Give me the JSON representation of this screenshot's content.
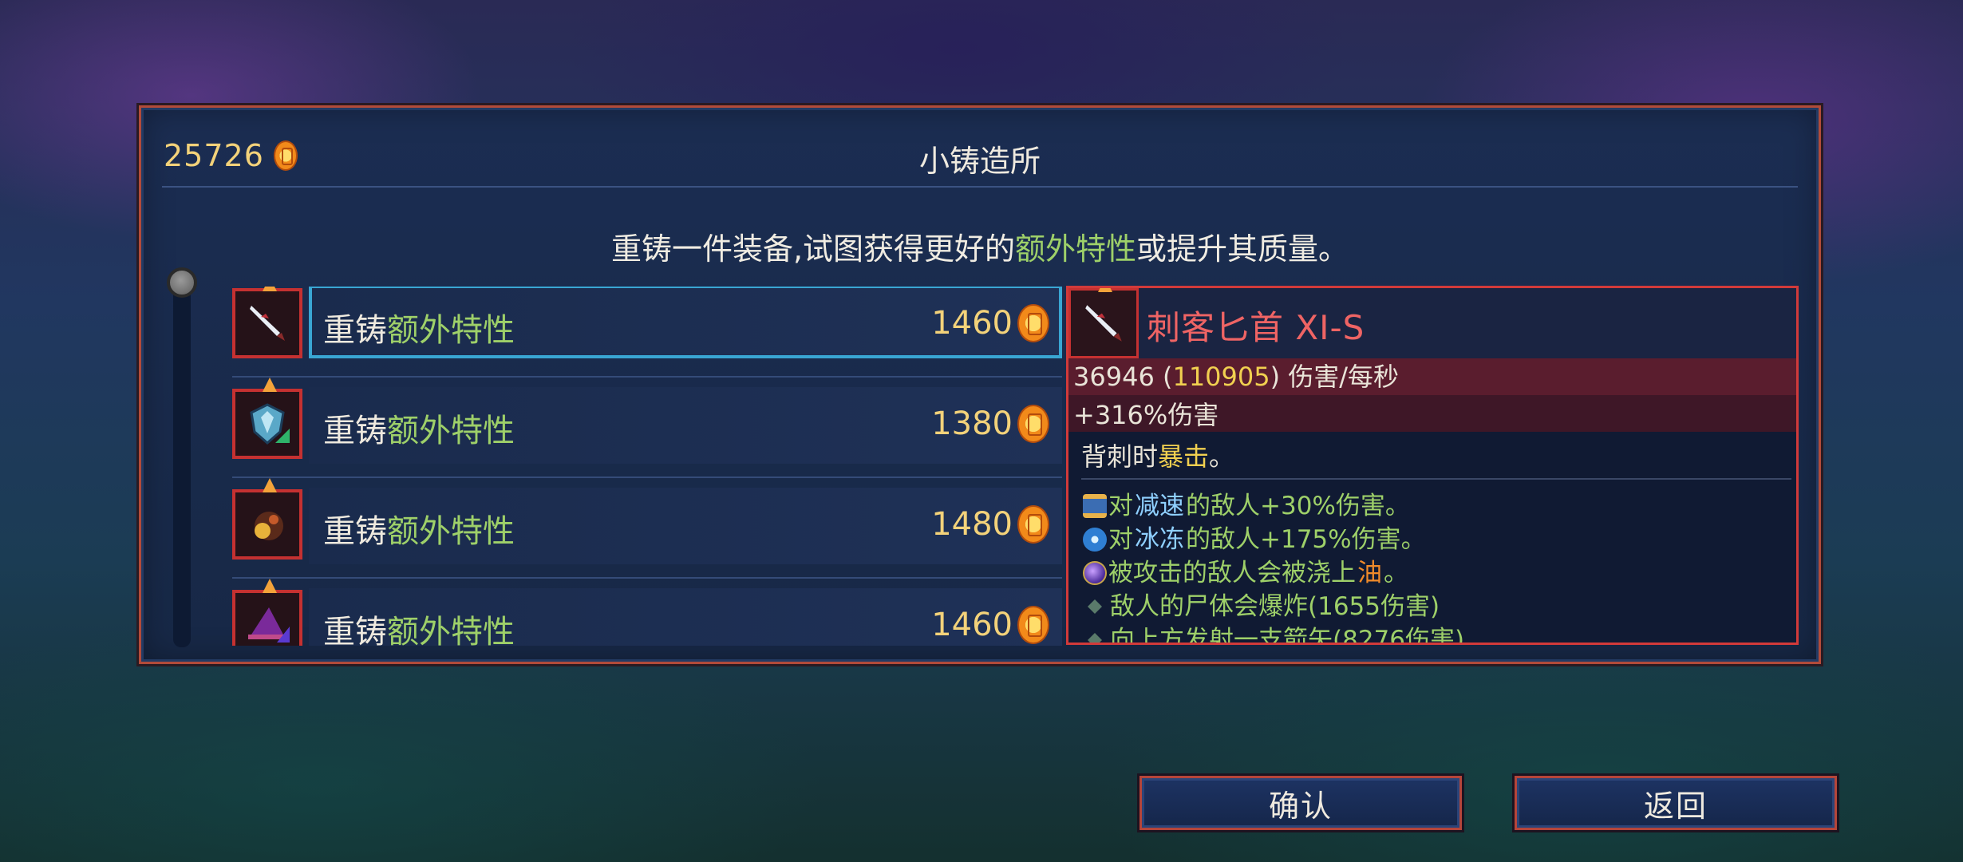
{
  "header": {
    "gold": "25726",
    "title": "小铸造所"
  },
  "subtitle": {
    "part1": "重铸一件装备,试图获得更好的",
    "highlight": "额外特性",
    "part2": "或提升其质量。"
  },
  "list": {
    "items": [
      {
        "label_prefix": "重铸",
        "label_highlight": "额外特性",
        "price": "1460",
        "icon": "dagger-icon"
      },
      {
        "label_prefix": "重铸",
        "label_highlight": "额外特性",
        "price": "1380",
        "icon": "shield-icon"
      },
      {
        "label_prefix": "重铸",
        "label_highlight": "额外特性",
        "price": "1480",
        "icon": "pet-icon"
      },
      {
        "label_prefix": "重铸",
        "label_highlight": "额外特性",
        "price": "1460",
        "icon": "hat-icon"
      }
    ]
  },
  "detail": {
    "name": "刺客匕首 XI-S",
    "dps": "36946",
    "dps_crit": "110905",
    "dps_unit": "伤害/每秒",
    "bonus": "+316%伤害",
    "effect_prefix": "背刺时",
    "effect_highlight": "暴击",
    "effect_suffix": "。",
    "mods": [
      {
        "pre": "对",
        "hl": "减速",
        "post": "的敌人+30%伤害。"
      },
      {
        "pre": "对",
        "hl": "冰冻",
        "post": "的敌人+175%伤害。"
      },
      {
        "pre": "被攻击的敌人会被浇上",
        "hl": "油",
        "post": "。"
      },
      {
        "text": "敌人的尸体会爆炸(1655伤害)"
      },
      {
        "text": "向上方发射一支箭矢(8276伤害)"
      }
    ]
  },
  "buttons": {
    "confirm": "确认",
    "back": "返回"
  },
  "colors": {
    "accent_green": "#9ed069",
    "gold": "#f3d27a",
    "frame_red": "#b24b3a",
    "selection_blue": "#39a6d3"
  }
}
